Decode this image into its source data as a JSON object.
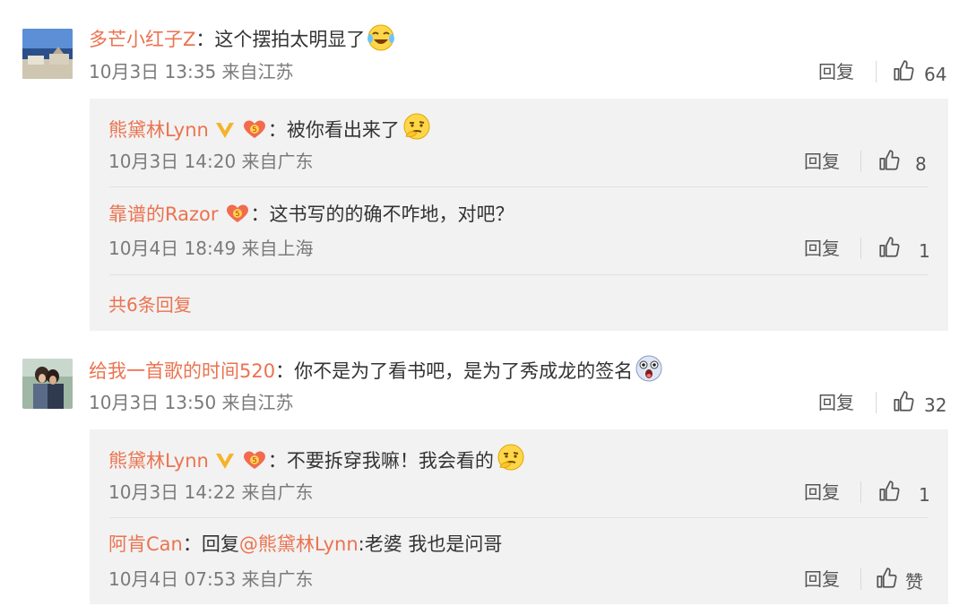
{
  "comments": [
    {
      "user": "多芒小红子Z",
      "colon": "：",
      "text": "这个摆拍太明显了",
      "date": "10月3日 13:35 来自江苏",
      "reply_label": "回复",
      "likes": "64",
      "replies": [
        {
          "user": "熊黛林Lynn",
          "colon": "：",
          "text": "被你看出来了",
          "date": "10月3日 14:20 来自广东",
          "reply_label": "回复",
          "likes": "8"
        },
        {
          "user": "靠谱的Razor",
          "colon": "：",
          "text": "这书写的的确不咋地，对吧？",
          "date": "10月4日 18:49 来自上海",
          "reply_label": "回复",
          "likes": "1"
        }
      ],
      "more_replies": "共6条回复"
    },
    {
      "user": "给我一首歌的时间520",
      "colon": "：",
      "text": "你不是为了看书吧，是为了秀成龙的签名",
      "date": "10月3日 13:50 来自江苏",
      "reply_label": "回复",
      "likes": "32",
      "replies": [
        {
          "user": "熊黛林Lynn",
          "colon": "：",
          "text": "不要拆穿我嘛！我会看的",
          "date": "10月3日 14:22 来自广东",
          "reply_label": "回复",
          "likes": "1"
        },
        {
          "user": "阿肯Can",
          "colon": "：",
          "reply_prefix": "回复",
          "mention": "@熊黛林Lynn",
          "text_after": ":老婆 我也是问哥",
          "date": "10月4日 07:53 来自广东",
          "reply_label": "回复",
          "likes": "赞"
        }
      ]
    }
  ],
  "colors": {
    "username": "#eb7350",
    "text": "#333333",
    "meta": "#7a7a7a",
    "reply_bg": "#f2f2f2",
    "badge_gold": "#f5b32b"
  },
  "icons": {
    "like": "thumbs-up-icon",
    "verified": "verified-v-icon",
    "fan_badge": "heart-badge-icon",
    "laugh": "laugh-cry-emoji-icon",
    "thinking": "thinking-emoji-icon",
    "surprised": "surprised-emoji-icon"
  }
}
